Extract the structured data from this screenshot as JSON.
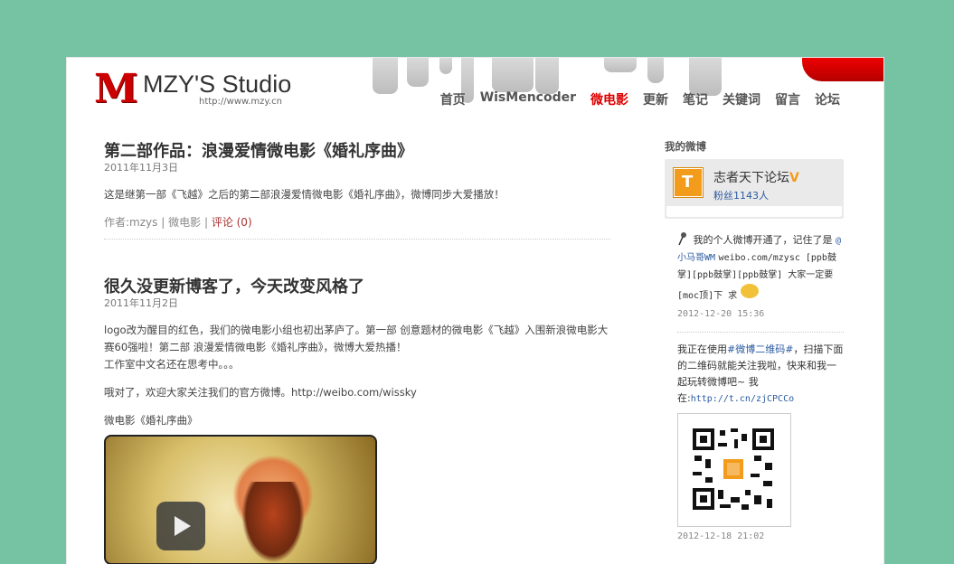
{
  "logo": {
    "letter": "M",
    "name": "MZY'S Studio",
    "url": "http://www.mzy.cn"
  },
  "nav": [
    {
      "label": "首页",
      "active": false
    },
    {
      "label": "WisMencoder",
      "active": false
    },
    {
      "label": "微电影",
      "active": true
    },
    {
      "label": "更新",
      "active": false
    },
    {
      "label": "笔记",
      "active": false
    },
    {
      "label": "关键词",
      "active": false
    },
    {
      "label": "留言",
      "active": false
    },
    {
      "label": "论坛",
      "active": false
    }
  ],
  "posts": [
    {
      "title": "第二部作品：浪漫爱情微电影《婚礼序曲》",
      "date": "2011年11月3日",
      "body": [
        "这是继第一部《飞越》之后的第二部浪漫爱情微电影《婚礼序曲》，微博同步大爱播放！"
      ],
      "author": "作者:mzys",
      "sep": "|",
      "category": "微电影",
      "comments": "评论 (0)"
    },
    {
      "title": "很久没更新博客了，今天改变风格了",
      "date": "2011年11月2日",
      "body": [
        "logo改为醒目的红色，我们的微电影小组也初出茅庐了。第一部 创意题材的微电影《飞越》入围新浪微电影大赛60强啦！第二部 浪漫爱情微电影《婚礼序曲》，微博大爱热播！",
        "工作室中文名还在思考中。。。",
        "哦对了，欢迎大家关注我们的官方微博。http://weibo.com/wissky",
        "微电影《婚礼序曲》"
      ]
    }
  ],
  "sidebar": {
    "heading": "我的微博",
    "profile": {
      "name": "志者天下论坛",
      "verified_mark": "V",
      "fans": "粉丝1143人"
    },
    "feed": [
      {
        "text_a": "我的个人微博开通了，记住了是 ",
        "mention": "@小马哥WM",
        "text_b": " weibo.com/mzysc [ppb鼓掌][ppb鼓掌][ppb鼓掌] 大家一定要[moc顶]下 求",
        "time": "2012-12-20 15:36"
      },
      {
        "text_a": "我正在使用",
        "tag": "#微博二维码#",
        "text_b": "，扫描下面的二维码就能关注我啦，快来和我一起玩转微博吧~ 我在:",
        "link": "http://t.cn/zjCPCCo",
        "time": "2012-12-18 21:02"
      }
    ]
  },
  "colors": {
    "background": "#76c3a4",
    "accent": "#dd0000",
    "link": "#2a5aa0"
  }
}
